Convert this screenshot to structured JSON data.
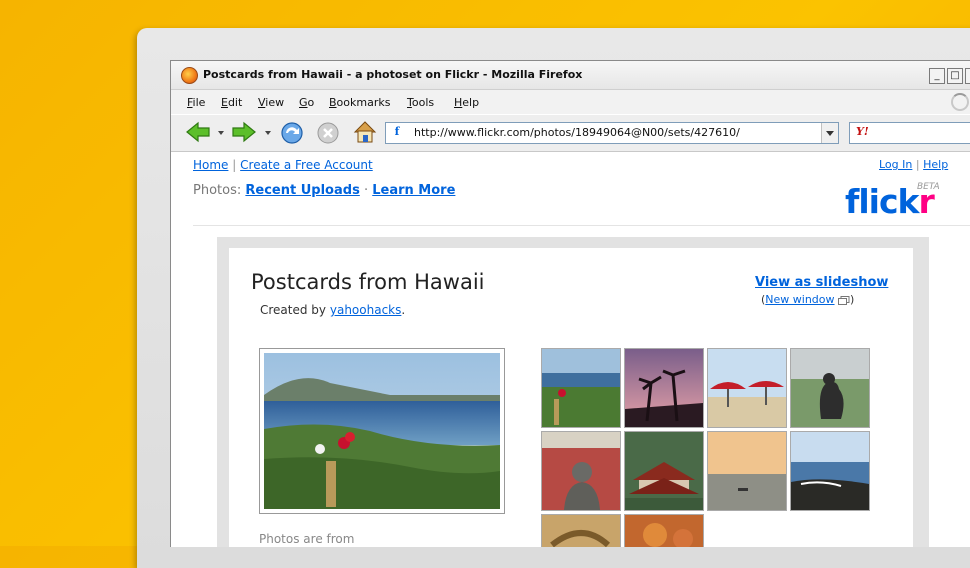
{
  "window": {
    "title": "Postcards from Hawaii - a photoset on Flickr - Mozilla Firefox",
    "minimize": "_",
    "maximize": "□",
    "close": "X"
  },
  "menu": {
    "items": [
      "File",
      "Edit",
      "View",
      "Go",
      "Bookmarks",
      "Tools",
      "Help"
    ]
  },
  "toolbar": {
    "url": "http://www.flickr.com/photos/18949064@N00/sets/427610/",
    "favicon": "f",
    "search_logo": "Y!"
  },
  "page": {
    "nav": {
      "home": "Home",
      "separator": "|",
      "create_account": "Create a Free Account"
    },
    "user_links": {
      "login": "Log In",
      "separator": "|",
      "help": "Help"
    },
    "photos_bar": {
      "label": "Photos:",
      "recent_uploads": "Recent Uploads",
      "dot": "·",
      "learn_more": "Learn More"
    },
    "logo": {
      "flickr_part1": "flick",
      "flickr_part2": "r",
      "beta": "BETA"
    },
    "set": {
      "title": "Postcards from Hawaii",
      "created_by_label": "Created by",
      "author": "yahoohacks",
      "period": ".",
      "slideshow": "View as slideshow",
      "open_paren": "(",
      "new_window": "New window",
      "close_paren": ")",
      "caption_start": "Photos are from"
    }
  },
  "colors": {
    "flickr_blue": "#0063dc",
    "flickr_pink": "#ff0084",
    "background": "#f6b400"
  }
}
